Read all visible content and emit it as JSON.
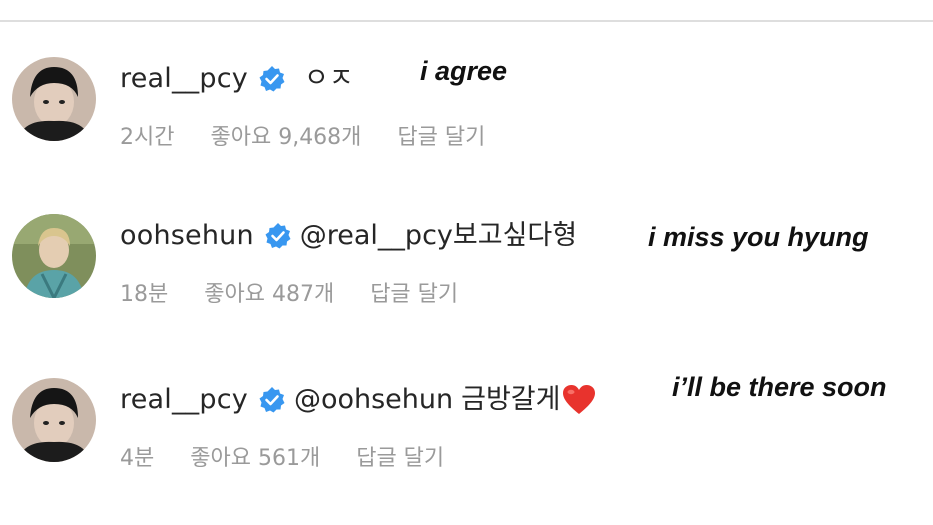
{
  "comments": [
    {
      "username": "real__pcy",
      "verified": true,
      "mention": "",
      "text": "ㅇㅈ",
      "time": "2시간",
      "likes": "좋아요 9,468개",
      "reply": "답글 달기",
      "avatar": "profile-photo-dark-hair",
      "translation": "i agree"
    },
    {
      "username": "oohsehun",
      "verified": true,
      "mention": "@real__pcy",
      "text": "보고싶다형",
      "time": "18분",
      "likes": "좋아요 487개",
      "reply": "답글 달기",
      "avatar": "profile-photo-outdoor-blond",
      "translation": "i miss you hyung"
    },
    {
      "username": "real__pcy",
      "verified": true,
      "mention": "@oohsehun",
      "text": "금방갈게",
      "time": "4분",
      "likes": "좋아요 561개",
      "reply": "답글 달기",
      "avatar": "profile-photo-dark-hair",
      "emoji": "heart-icon",
      "translation": "i’ll be there soon"
    }
  ],
  "colors": {
    "verified_badge": "#3897f0",
    "meta_text": "#9a9a9a",
    "heart": "#e8332d",
    "divider": "#dedede"
  }
}
